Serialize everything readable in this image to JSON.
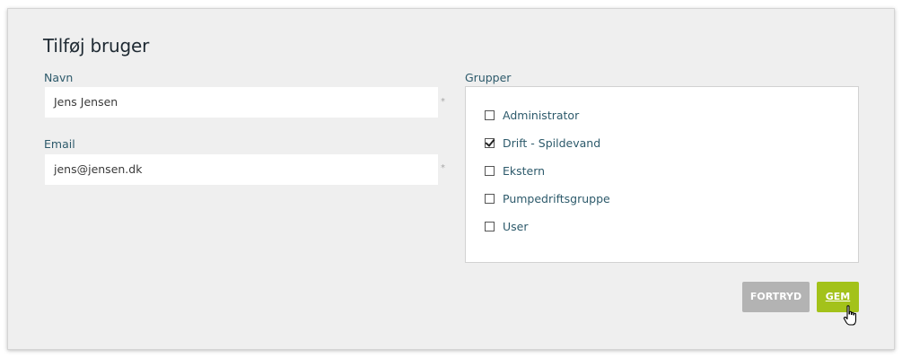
{
  "form": {
    "title": "Tilføj bruger",
    "name": {
      "label": "Navn",
      "value": "Jens Jensen",
      "required_marker": "*"
    },
    "email": {
      "label": "Email",
      "value": "jens@jensen.dk",
      "required_marker": "*"
    },
    "groups": {
      "label": "Grupper",
      "items": [
        {
          "label": "Administrator",
          "checked": false
        },
        {
          "label": "Drift - Spildevand",
          "checked": true
        },
        {
          "label": "Ekstern",
          "checked": false
        },
        {
          "label": "Pumpedriftsgruppe",
          "checked": false
        },
        {
          "label": "User",
          "checked": false
        }
      ]
    },
    "buttons": {
      "cancel_label": "FORTRYD",
      "save_label": "GEM"
    }
  },
  "colors": {
    "panel_bg": "#efefef",
    "label_text": "#2d5a6b",
    "cancel_button": "#b3b3b3",
    "save_button": "#a3c21a"
  },
  "icons": {
    "cursor": "hand-pointer-icon"
  }
}
